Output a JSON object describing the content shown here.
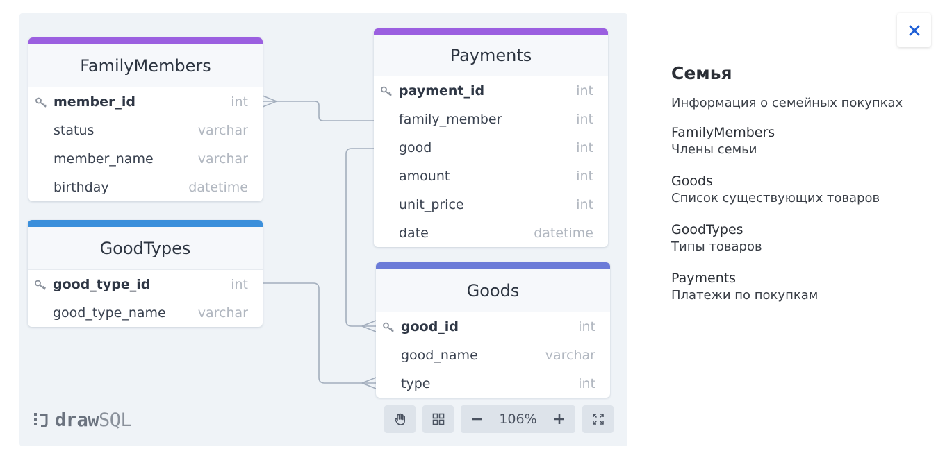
{
  "diagram": {
    "tables": [
      {
        "name": "FamilyMembers",
        "accent": "#9b5fe0",
        "fields": [
          {
            "name": "member_id",
            "type": "int",
            "pk": true
          },
          {
            "name": "status",
            "type": "varchar"
          },
          {
            "name": "member_name",
            "type": "varchar"
          },
          {
            "name": "birthday",
            "type": "datetime"
          }
        ]
      },
      {
        "name": "Payments",
        "accent": "#9b5fe0",
        "fields": [
          {
            "name": "payment_id",
            "type": "int",
            "pk": true
          },
          {
            "name": "family_member",
            "type": "int"
          },
          {
            "name": "good",
            "type": "int"
          },
          {
            "name": "amount",
            "type": "int"
          },
          {
            "name": "unit_price",
            "type": "int"
          },
          {
            "name": "date",
            "type": "datetime"
          }
        ]
      },
      {
        "name": "GoodTypes",
        "accent": "#3b8fdb",
        "fields": [
          {
            "name": "good_type_id",
            "type": "int",
            "pk": true
          },
          {
            "name": "good_type_name",
            "type": "varchar"
          }
        ]
      },
      {
        "name": "Goods",
        "accent": "#6b7bd8",
        "fields": [
          {
            "name": "good_id",
            "type": "int",
            "pk": true
          },
          {
            "name": "good_name",
            "type": "varchar"
          },
          {
            "name": "type",
            "type": "int"
          }
        ]
      }
    ],
    "relations": [
      {
        "from": "Payments.family_member",
        "to": "FamilyMembers.member_id"
      },
      {
        "from": "Payments.good",
        "to": "Goods.good_id"
      },
      {
        "from": "GoodTypes.good_type_id",
        "to": "Goods.type"
      }
    ],
    "logo": {
      "bold": "draw",
      "light": "SQL"
    },
    "toolbar": {
      "zoom": "106%",
      "zoom_out": "−",
      "zoom_in": "+"
    },
    "colors": {
      "canvas": "#eff3f7",
      "line": "#a3aebd",
      "close": "#1f5fd6"
    }
  },
  "sidebar": {
    "title": "Семья",
    "description": "Информация о семейных покупках",
    "entities": [
      {
        "name": "FamilyMembers",
        "desc": "Члены семьи"
      },
      {
        "name": "Goods",
        "desc": "Список существующих товаров"
      },
      {
        "name": "GoodTypes",
        "desc": "Типы товаров"
      },
      {
        "name": "Payments",
        "desc": "Платежи по покупкам"
      }
    ]
  }
}
